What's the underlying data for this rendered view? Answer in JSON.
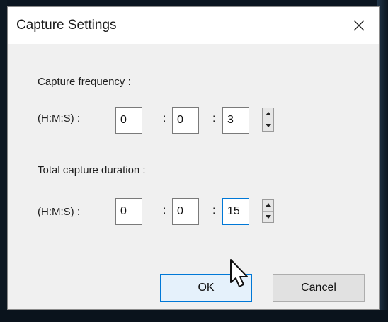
{
  "dialog": {
    "title": "Capture Settings",
    "close_icon": "close-icon"
  },
  "frequency": {
    "label": "Capture frequency :",
    "format_label": "(H:M:S) :",
    "hours": "0",
    "minutes": "0",
    "seconds": "3",
    "separator": ":"
  },
  "duration": {
    "label": "Total capture duration :",
    "format_label": "(H:M:S) :",
    "hours": "0",
    "minutes": "0",
    "seconds": "15",
    "separator": ":"
  },
  "buttons": {
    "ok": "OK",
    "cancel": "Cancel"
  },
  "colors": {
    "accent": "#0078d7",
    "dialog_bg": "#f0f0f0",
    "titlebar_bg": "#ffffff"
  }
}
